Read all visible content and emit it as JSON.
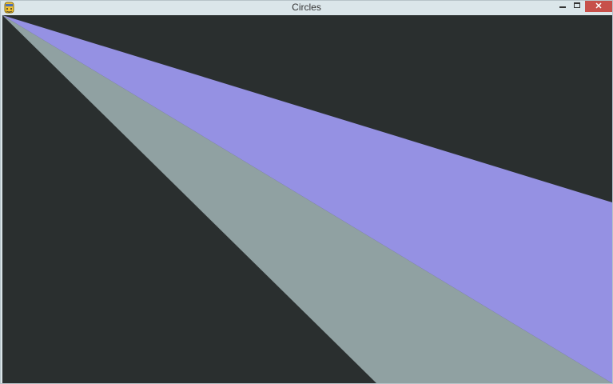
{
  "window": {
    "title": "Circles"
  },
  "icons": {
    "app": "python-icon",
    "minimize": "minimize-icon",
    "maximize": "maximize-icon",
    "close": "close-icon"
  },
  "colors": {
    "canvas_background": "#2a2f2f",
    "wedge_gray": "#90a1a2",
    "wedge_purple": "#9591e3",
    "close_button": "#c7504a"
  }
}
